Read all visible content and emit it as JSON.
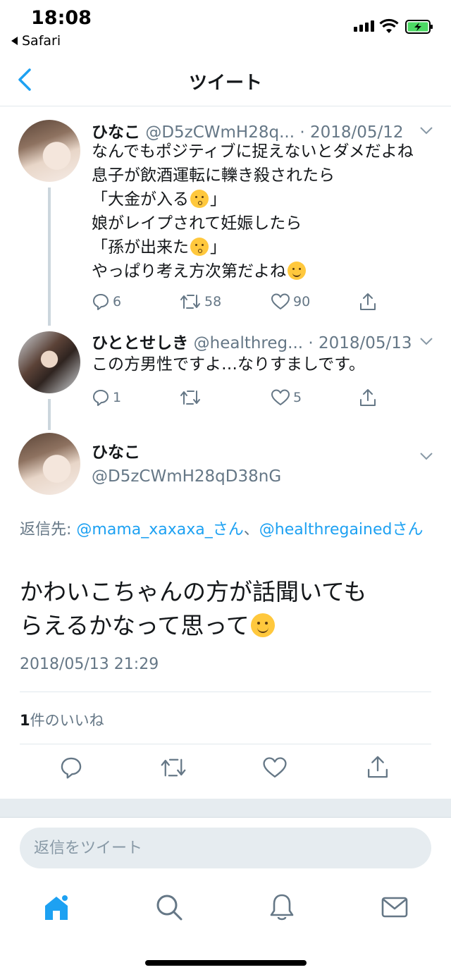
{
  "status_bar": {
    "time": "18:08",
    "back_app": "Safari"
  },
  "nav": {
    "title": "ツイート"
  },
  "tweets": [
    {
      "name": "ひなこ",
      "meta": "@D5zCWmH28q... · 2018/05/12",
      "lines": [
        "なんでもポジティブに捉えないとダメだよね",
        "息子が飲酒運転に轢き殺されたら",
        "「大金が入る",
        "」",
        "娘がレイプされて妊娠したら",
        "「孫が出来た",
        "」",
        "やっぱり考え方次第だよね"
      ],
      "reply_count": "6",
      "retweet_count": "58",
      "like_count": "90"
    },
    {
      "name": "ひととせしき",
      "meta": "@healthreg... · 2018/05/13",
      "text": "この方男性ですよ…なりすましです。",
      "reply_count": "1",
      "retweet_count": "",
      "like_count": "5"
    }
  ],
  "main_tweet": {
    "name": "ひなこ",
    "handle": "@D5zCWmH28qD38nG",
    "reply_prefix": "返信先: ",
    "reply_user1": "@mama_xaxaxa_さん",
    "reply_sep": "、",
    "reply_user2": "@healthregainedさん",
    "text_line1": "かわいこちゃんの方が話聞いても",
    "text_line2": "らえるかなって思って",
    "timestamp": "2018/05/13 21:29",
    "likes_count": "1",
    "likes_label": "件のいいね"
  },
  "reply_box": {
    "placeholder": "返信をツイート"
  },
  "colors": {
    "accent": "#1da1f2",
    "secondary_text": "#657786",
    "divider": "#e1e8ed",
    "icon_gray": "#657786"
  },
  "tabs": [
    "home-icon",
    "search-icon",
    "notifications-icon",
    "messages-icon"
  ]
}
